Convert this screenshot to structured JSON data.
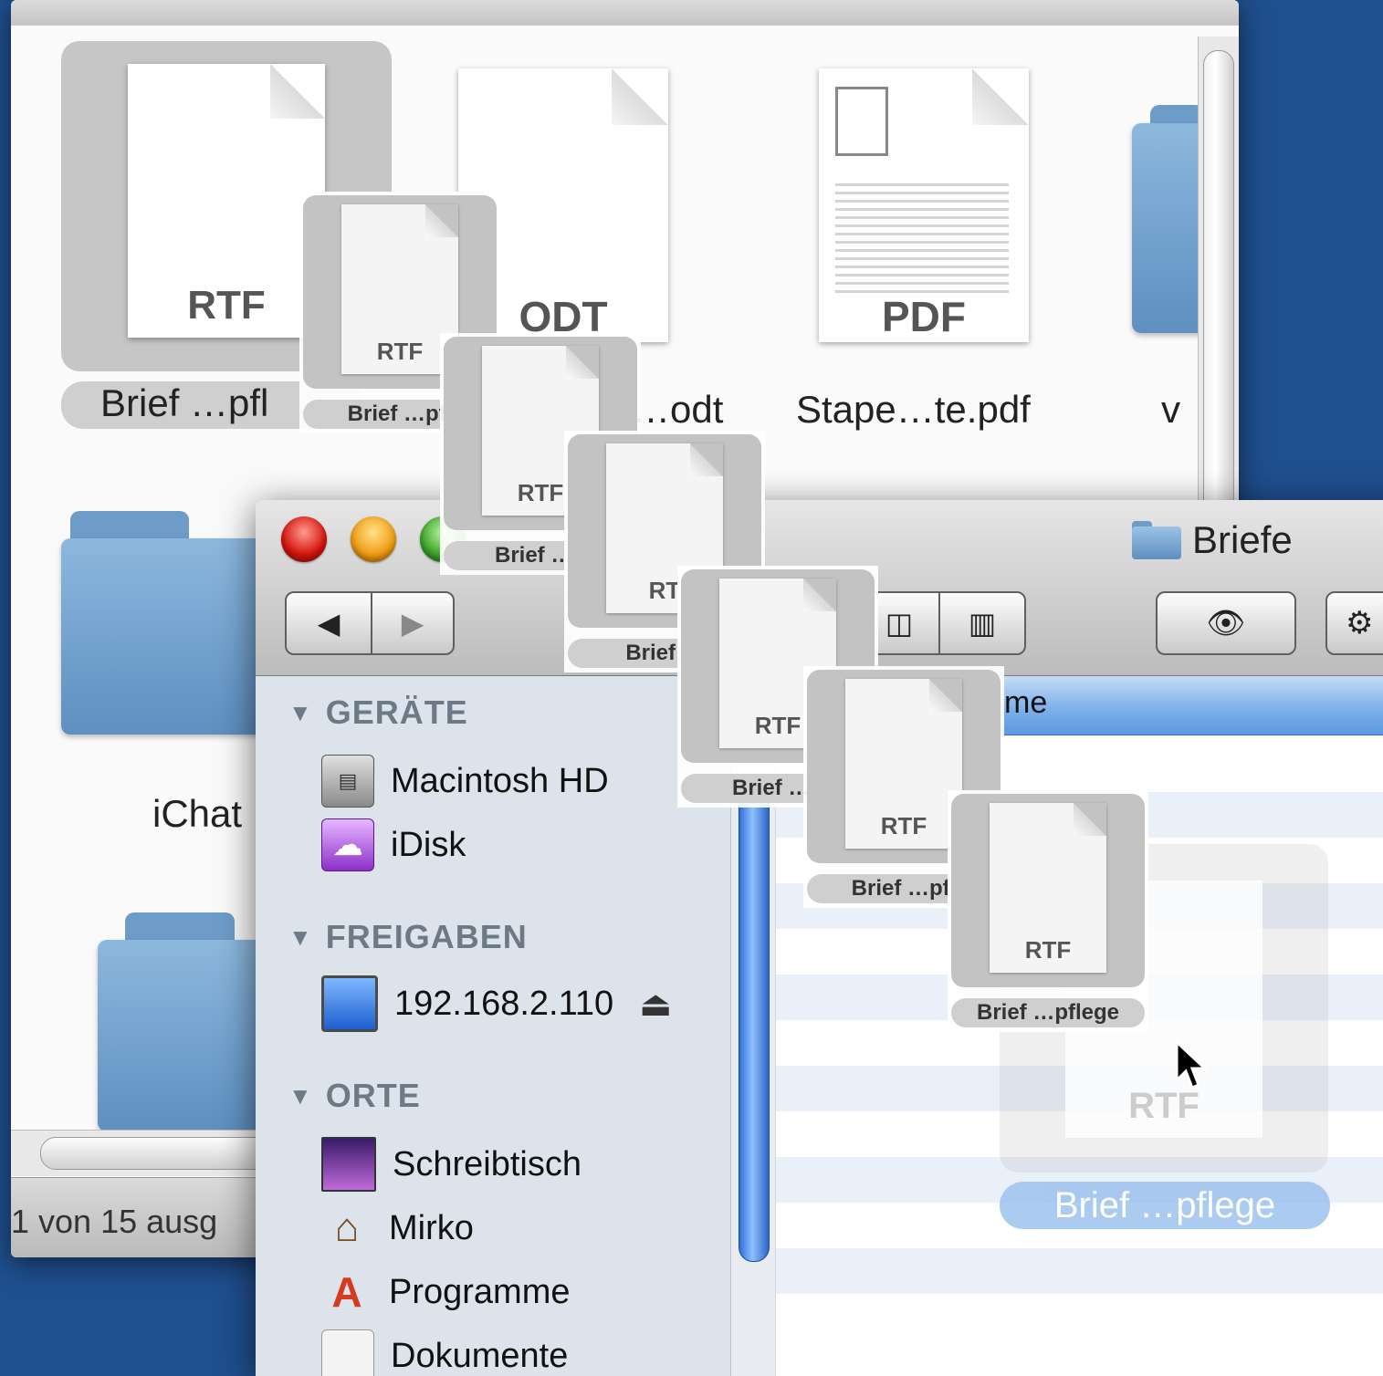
{
  "back_window": {
    "status_text": "1 von 15 ausg",
    "files": [
      {
        "type": "RTF",
        "label": "Brief …pfl"
      },
      {
        "type": "ODT",
        "label": "…odt"
      },
      {
        "type": "PDF",
        "label": "Stape…te.pdf"
      },
      {
        "label": "v"
      }
    ],
    "folders": [
      {
        "label": "iChat"
      }
    ]
  },
  "front_window": {
    "title": "Briefe",
    "nav": {
      "back_glyph": "◀",
      "forward_glyph": "▶"
    },
    "view_buttons": {
      "column_glyph": "◫",
      "coverflow_glyph": "▥"
    },
    "quicklook_glyph": "👁",
    "action_glyph": "⚙",
    "list_header": "me",
    "sidebar": {
      "sections": [
        {
          "heading": "GERÄTE",
          "items": [
            {
              "label": "Macintosh HD",
              "icon": "hard-drive-icon"
            },
            {
              "label": "iDisk",
              "icon": "idisk-icon"
            }
          ]
        },
        {
          "heading": "FREIGABEN",
          "items": [
            {
              "label": "192.168.2.110",
              "icon": "network-computer-icon",
              "eject": "⏏"
            }
          ]
        },
        {
          "heading": "ORTE",
          "items": [
            {
              "label": "Schreibtisch",
              "icon": "desktop-icon"
            },
            {
              "label": "Mirko",
              "icon": "home-icon"
            },
            {
              "label": "Programme",
              "icon": "applications-icon"
            },
            {
              "label": "Dokumente",
              "icon": "documents-icon"
            }
          ]
        }
      ]
    },
    "drop_ghost": {
      "type": "RTF",
      "label": "Brief …pflege"
    }
  },
  "drag_stack": [
    {
      "type": "RTF",
      "label": "Brief …pfl"
    },
    {
      "type": "RTF",
      "label": "Brief …p"
    },
    {
      "type": "RT",
      "label": "Brief …"
    },
    {
      "type": "RTF",
      "label": "Brief …p"
    },
    {
      "type": "RTF",
      "label": "Brief …pfl"
    },
    {
      "type": "RTF",
      "label": "Brief …pflege"
    }
  ],
  "colors": {
    "desktop": "#1f4f8e",
    "selection_blue": "#5d98e0",
    "sidebar_bg": "#dde3ea"
  }
}
